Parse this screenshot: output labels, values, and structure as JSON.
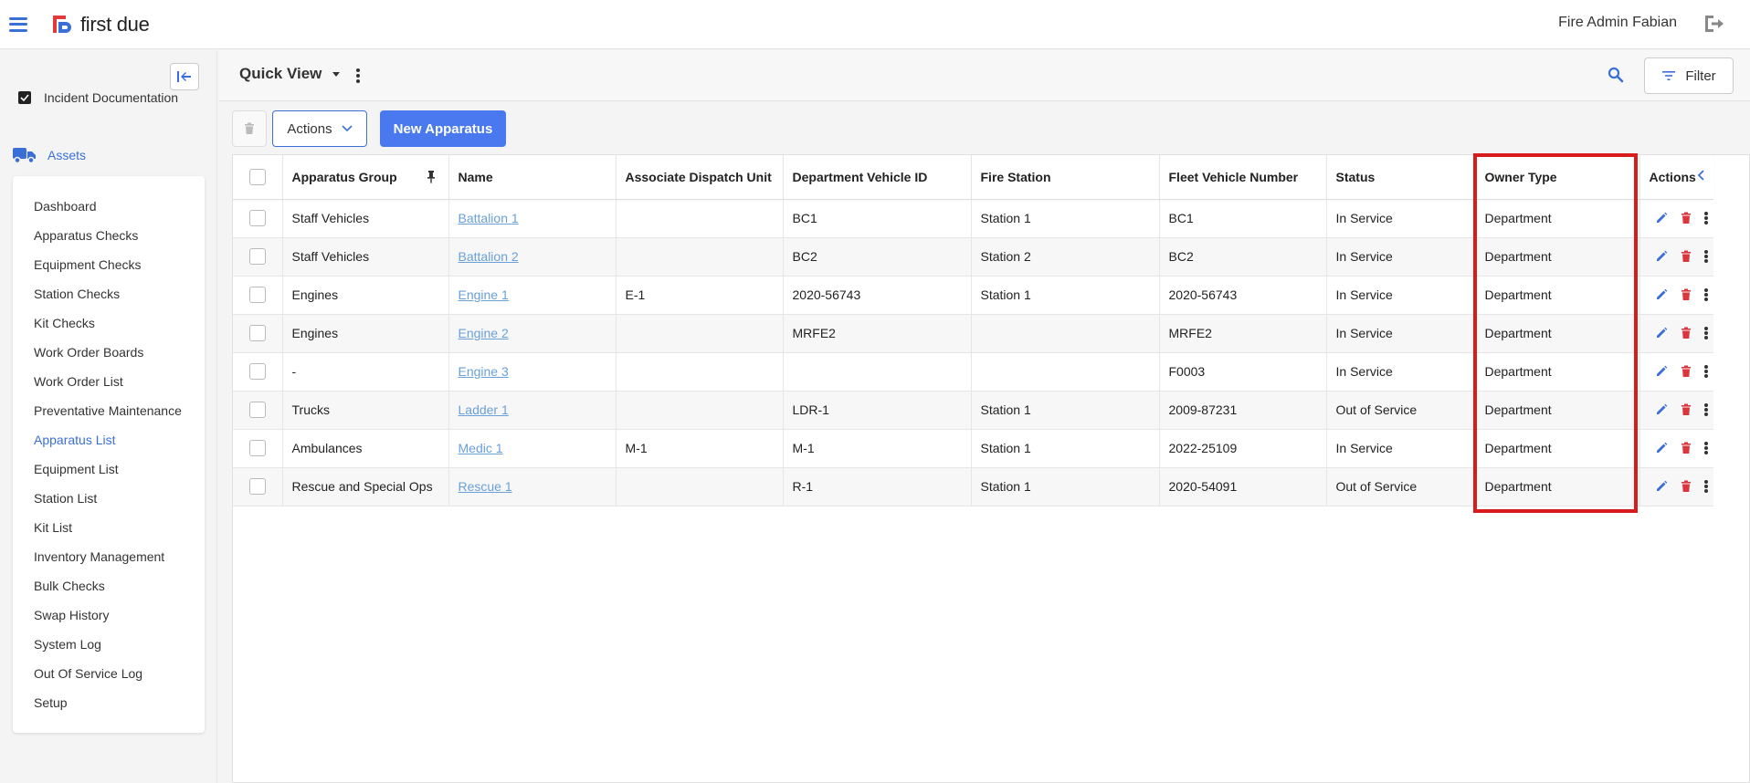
{
  "topbar": {
    "brand": "first due",
    "user_name": "Fire Admin Fabian"
  },
  "sidebar": {
    "incident_label": "Incident Documentation",
    "assets_label": "Assets",
    "items": [
      {
        "label": "Dashboard",
        "active": false
      },
      {
        "label": "Apparatus Checks",
        "active": false
      },
      {
        "label": "Equipment Checks",
        "active": false
      },
      {
        "label": "Station Checks",
        "active": false
      },
      {
        "label": "Kit Checks",
        "active": false
      },
      {
        "label": "Work Order Boards",
        "active": false
      },
      {
        "label": "Work Order List",
        "active": false
      },
      {
        "label": "Preventative Maintenance",
        "active": false
      },
      {
        "label": "Apparatus List",
        "active": true
      },
      {
        "label": "Equipment List",
        "active": false
      },
      {
        "label": "Station List",
        "active": false
      },
      {
        "label": "Kit List",
        "active": false
      },
      {
        "label": "Inventory Management",
        "active": false
      },
      {
        "label": "Bulk Checks",
        "active": false
      },
      {
        "label": "Swap History",
        "active": false
      },
      {
        "label": "System Log",
        "active": false
      },
      {
        "label": "Out Of Service Log",
        "active": false
      },
      {
        "label": "Setup",
        "active": false
      }
    ]
  },
  "toolbar": {
    "view_label": "Quick View",
    "filter_label": "Filter",
    "actions_label": "Actions",
    "new_label": "New Apparatus"
  },
  "table": {
    "columns": [
      "Apparatus Group",
      "Name",
      "Associate Dispatch Unit",
      "Department Vehicle ID",
      "Fire Station",
      "Fleet Vehicle Number",
      "Status",
      "Owner Type",
      "Actions"
    ],
    "rows": [
      [
        "Staff Vehicles",
        "Battalion 1",
        "",
        "BC1",
        "Station 1",
        "BC1",
        "In Service",
        "Department"
      ],
      [
        "Staff Vehicles",
        "Battalion 2",
        "",
        "BC2",
        "Station 2",
        "BC2",
        "In Service",
        "Department"
      ],
      [
        "Engines",
        "Engine 1",
        "E-1",
        "2020-56743",
        "Station 1",
        "2020-56743",
        "In Service",
        "Department"
      ],
      [
        "Engines",
        "Engine 2",
        "",
        "MRFE2",
        "",
        "MRFE2",
        "In Service",
        "Department"
      ],
      [
        "-",
        "Engine 3",
        "",
        "",
        "",
        "F0003",
        "In Service",
        "Department"
      ],
      [
        "Trucks",
        "Ladder 1",
        "",
        "LDR-1",
        "Station 1",
        "2009-87231",
        "Out of Service",
        "Department"
      ],
      [
        "Ambulances",
        "Medic 1",
        "M-1",
        "M-1",
        "Station 1",
        "2022-25109",
        "In Service",
        "Department"
      ],
      [
        "Rescue and Special Ops",
        "Rescue 1",
        "",
        "R-1",
        "Station 1",
        "2020-54091",
        "Out of Service",
        "Department"
      ]
    ]
  },
  "colors": {
    "accent": "#3b6fd8",
    "primary_button": "#4a78ef",
    "delete_icon": "#d9363e",
    "highlight": "#d81b1b",
    "link": "#6aa0d8"
  },
  "icons": {
    "menu": "hamburger-icon",
    "logout": "logout-icon",
    "search": "search-icon",
    "filter": "filter-icon",
    "edit": "pencil-icon",
    "delete": "trash-icon",
    "more": "kebab-icon",
    "pin": "pin-icon"
  }
}
